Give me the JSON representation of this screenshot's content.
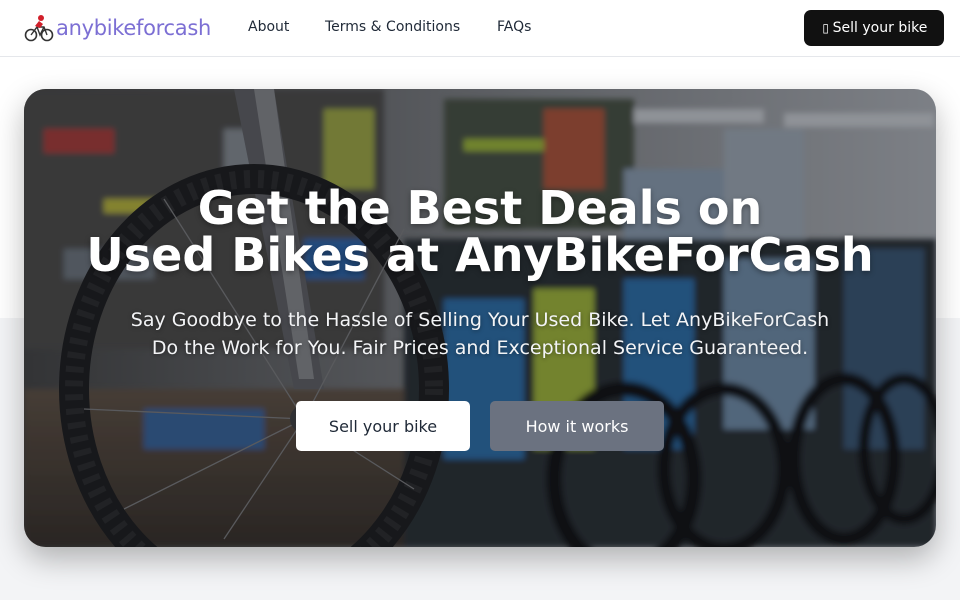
{
  "header": {
    "logo_text": "anybikeforcash",
    "nav": [
      {
        "label": "About"
      },
      {
        "label": "Terms & Conditions"
      },
      {
        "label": "FAQs"
      }
    ],
    "cta": {
      "icon": "bike-icon",
      "label": "Sell your bike"
    }
  },
  "hero": {
    "title_line1": "Get the Best Deals on",
    "title_line2": "Used Bikes at AnyBikeForCash",
    "subtitle_line1": "Say Goodbye to the Hassle of Selling Your Used Bike. Let AnyBikeForCash",
    "subtitle_line2": "Do the Work for You. Fair Prices and Exceptional Service Guaranteed.",
    "primary_button": "Sell your bike",
    "secondary_button": "How it works"
  },
  "colors": {
    "brand": "#7c6fd4",
    "cta_bg": "#111111",
    "secondary_button": "#6b7280",
    "page_band": "#f3f4f6"
  }
}
